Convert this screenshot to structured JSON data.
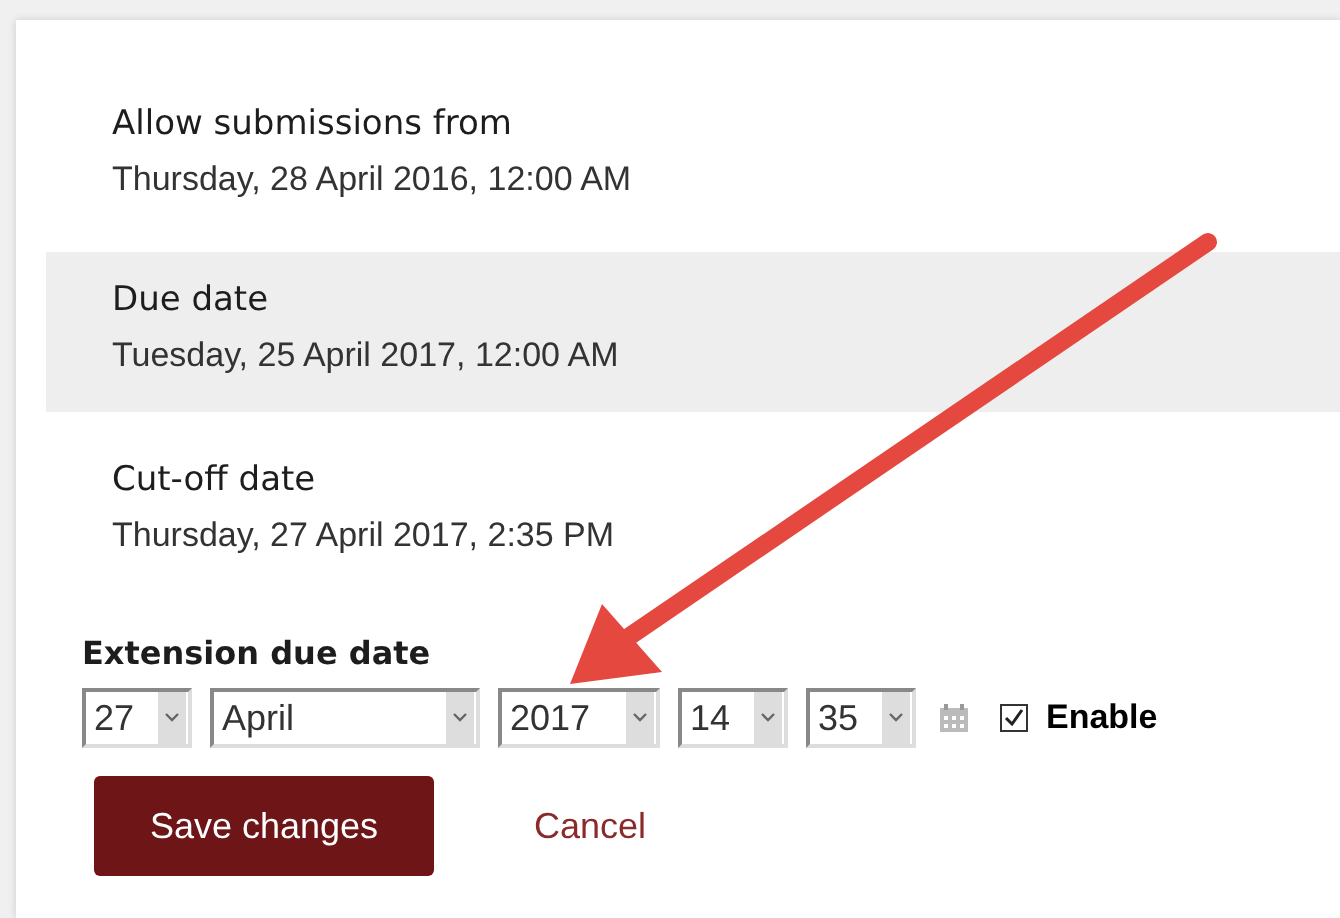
{
  "dates": [
    {
      "label": "Allow submissions from",
      "value": "Thursday, 28 April 2016, 12:00 AM",
      "selected": false
    },
    {
      "label": "Due date",
      "value": "Tuesday, 25 April 2017, 12:00 AM",
      "selected": true
    },
    {
      "label": "Cut-off date",
      "value": "Thursday, 27 April 2017, 2:35 PM",
      "selected": false
    }
  ],
  "extension": {
    "label": "Extension due date",
    "selects": [
      {
        "value": "27",
        "kind": "short"
      },
      {
        "value": "April",
        "kind": "long"
      },
      {
        "value": "2017",
        "kind": "medium"
      },
      {
        "value": "14",
        "kind": "short"
      },
      {
        "value": "35",
        "kind": "short"
      }
    ],
    "enable": {
      "label": "Enable",
      "checked": true
    }
  },
  "buttons": {
    "save": "Save changes",
    "cancel": "Cancel"
  }
}
